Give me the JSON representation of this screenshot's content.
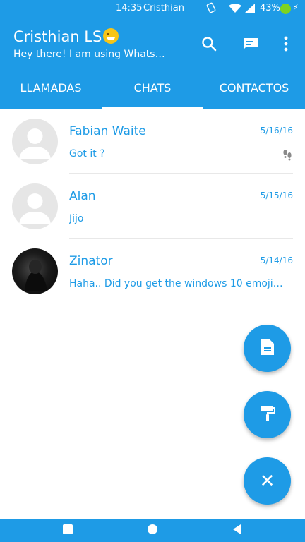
{
  "status_bar": {
    "time": "14:35",
    "carrier": "Cristhian",
    "battery": "43%"
  },
  "app_bar": {
    "title": "Cristhian LS",
    "subtitle": "Hey there! I am using Whats…",
    "icons": [
      "search-icon",
      "message-icon",
      "more-vert-icon"
    ]
  },
  "tabs": [
    {
      "label": "LLAMADAS",
      "active": false
    },
    {
      "label": "CHATS",
      "active": true
    },
    {
      "label": "CONTACTOS",
      "active": false
    }
  ],
  "chats": [
    {
      "name": "Fabian Waite",
      "date": "5/16/16",
      "message": "Got it ?",
      "avatar": "default",
      "status_icon": "footprints-icon"
    },
    {
      "name": "Alan",
      "date": "5/15/16",
      "message": "Jijo",
      "avatar": "default"
    },
    {
      "name": "Zinator",
      "date": "5/14/16",
      "message": "Haha.. Did you get the windows 10 emoji…",
      "avatar": "photo"
    }
  ],
  "fabs": [
    "document-icon",
    "paint-roller-icon",
    "close-icon"
  ],
  "nav_bar": [
    "recents-icon",
    "home-icon",
    "back-icon"
  ],
  "colors": {
    "primary": "#1e9be6",
    "avatar_bg": "#e6e6e6",
    "battery": "#7ed321"
  }
}
